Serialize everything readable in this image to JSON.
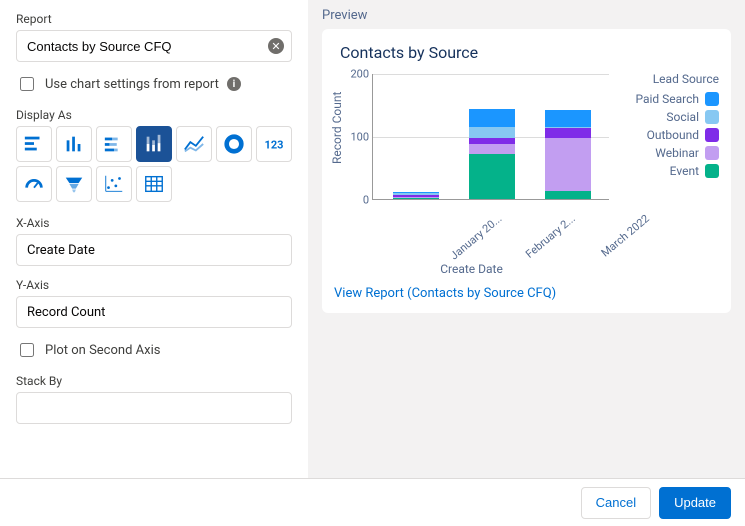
{
  "labels": {
    "report": "Report",
    "useChartSettings": "Use chart settings from report",
    "displayAs": "Display As",
    "xAxis": "X-Axis",
    "yAxis": "Y-Axis",
    "plotSecond": "Plot on Second Axis",
    "stackBy": "Stack By",
    "preview": "Preview",
    "cancel": "Cancel",
    "update": "Update"
  },
  "report": {
    "name": "Contacts by Source CFQ"
  },
  "xAxisValue": "Create Date",
  "yAxisValue": "Record Count",
  "preview": {
    "title": "Contacts by Source",
    "linkText": "View Report (Contacts by Source CFQ)"
  },
  "chart_data": {
    "type": "stacked-bar",
    "title": "Contacts by Source",
    "xlabel": "Create Date",
    "ylabel": "Record Count",
    "ylim": [
      0,
      200
    ],
    "yticks": [
      0,
      100,
      200
    ],
    "legend_title": "Lead Source",
    "categories": [
      "January 20...",
      "February 2...",
      "March 2022"
    ],
    "series": [
      {
        "name": "Paid Search",
        "color": "#1b96ff",
        "values": [
          2,
          28,
          28
        ]
      },
      {
        "name": "Social",
        "color": "#87c8f2",
        "values": [
          3,
          18,
          2
        ]
      },
      {
        "name": "Outbound",
        "color": "#7f2ce8",
        "values": [
          3,
          10,
          15
        ]
      },
      {
        "name": "Webinar",
        "color": "#c29ef1",
        "values": [
          2,
          15,
          85
        ]
      },
      {
        "name": "Event",
        "color": "#04b28a",
        "values": [
          2,
          72,
          12
        ]
      }
    ]
  }
}
